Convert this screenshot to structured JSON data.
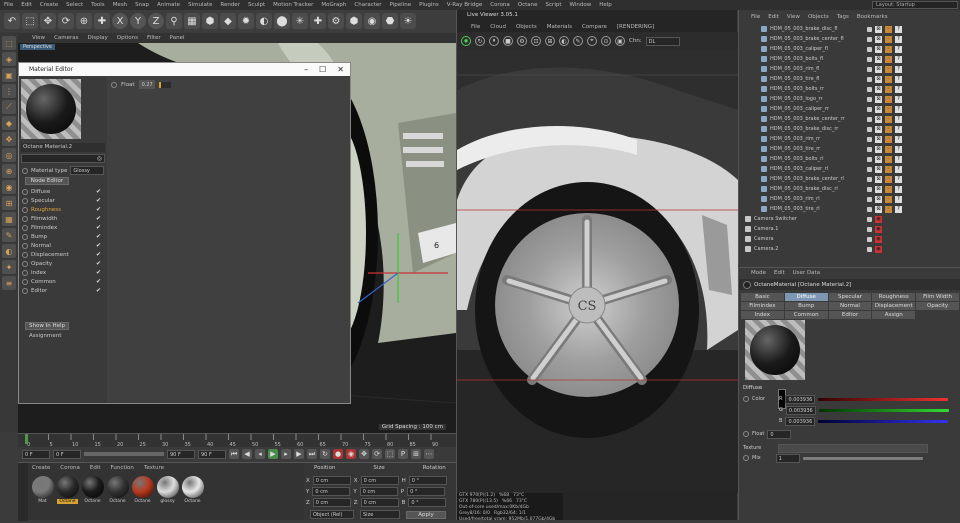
{
  "menubar": {
    "items": [
      "File",
      "Edit",
      "Create",
      "Select",
      "Tools",
      "Mesh",
      "Snap",
      "Animate",
      "Simulate",
      "Render",
      "Sculpt",
      "Motion Tracker",
      "MoGraph",
      "Character",
      "Pipeline",
      "Plugins",
      "V-Ray Bridge",
      "Corona",
      "Octane",
      "Script",
      "Window",
      "Help"
    ],
    "layout_label": "Layout:",
    "layout_value": "Startup"
  },
  "toolbar": {
    "undo": "↶",
    "icons": [
      "⬚",
      "✥",
      "⟳",
      "⊕",
      "✚",
      "X",
      "Y",
      "Z",
      "⚲",
      "▦",
      "⬢",
      "◆",
      "✹",
      "◐",
      "⬤",
      "✳",
      "✚",
      "⚙",
      "⬢",
      "◉",
      "⬣",
      "☀"
    ]
  },
  "viewport": {
    "menu": [
      "View",
      "Cameras",
      "Display",
      "Options",
      "Filter",
      "Panel"
    ],
    "perspective": "Perspective",
    "grid_spacing": "Grid Spacing : 100 cm",
    "badge_text": "6",
    "timeline_ticks": [
      "0",
      "5",
      "10",
      "15",
      "20",
      "25",
      "30",
      "35",
      "40",
      "45",
      "50",
      "55",
      "60",
      "65",
      "70",
      "75",
      "80",
      "85",
      "90"
    ],
    "frame_field": "0 F",
    "start_field": "0 F",
    "end_field": "90 F",
    "max_field": "90 F"
  },
  "material_editor": {
    "title": "Material Editor",
    "material_name": "Octane Material.2",
    "material_type_label": "Material type",
    "material_type_value": "Glossy",
    "node_editor": "Node Editor",
    "channels": [
      "Diffuse",
      "Specular",
      "Roughness",
      "Filmwidth",
      "Filmindex",
      "Bump",
      "Normal",
      "Displacement",
      "Opacity",
      "Index",
      "Common",
      "Editor"
    ],
    "active_channel": "Roughness",
    "show_in_help": "Show In Help",
    "assignment": "Assignment",
    "float_label": "Float",
    "float_value": "0.27"
  },
  "material_panel": {
    "menu": [
      "Create",
      "Corona",
      "Edit",
      "Function",
      "Texture"
    ],
    "balls": [
      {
        "label": "Mat",
        "color": "#7a7a7a"
      },
      {
        "label": "Octane",
        "color": "#2a2a2a"
      },
      {
        "label": "Octane",
        "color": "#1a1a1a"
      },
      {
        "label": "Octane",
        "color": "#333333"
      },
      {
        "label": "Octane",
        "color": "#b83a1e"
      },
      {
        "label": "glossy",
        "color": "#dddddd"
      },
      {
        "label": "Octane",
        "color": "#e8e8e8"
      }
    ],
    "selected_index": 1
  },
  "coordinates": {
    "headers": [
      "Position",
      "Size",
      "Rotation"
    ],
    "rows": [
      {
        "axis": "X",
        "pos": "0 cm",
        "size_axis": "X",
        "size": "0 cm",
        "rot_axis": "H",
        "rot": "0 °"
      },
      {
        "axis": "Y",
        "pos": "0 cm",
        "size_axis": "Y",
        "size": "0 cm",
        "rot_axis": "P",
        "rot": "0 °"
      },
      {
        "axis": "Z",
        "pos": "0 cm",
        "size_axis": "Z",
        "size": "0 cm",
        "rot_axis": "B",
        "rot": "0 °"
      }
    ],
    "mode_object": "Object (Rel)",
    "mode_size": "Size",
    "apply": "Apply"
  },
  "live_viewer": {
    "title": "Live Viewer 3.05.1",
    "menu": [
      "File",
      "Cloud",
      "Objects",
      "Materials",
      "Compare",
      "[RENDERING]"
    ],
    "channel_label": "Chn:",
    "channel_value": "DL",
    "stats": [
      {
        "a": "GTX 970(P)(1.2)",
        "b": "%68",
        "c": "73°C"
      },
      {
        "a": "GTX 780(P)(13.5)",
        "b": "%66",
        "c": "73°C"
      },
      {
        "a": "Out-of-core used/max:0Kb/4Gb",
        "b": "",
        "c": ""
      },
      {
        "a": "Grey8/16: 0/0",
        "b": "Rgb32/64: 1/1",
        "c": ""
      },
      {
        "a": "Used/free/total vram: 952Mb/1.077Gb/4Gb",
        "b": "",
        "c": ""
      }
    ],
    "wheel_logo": "CS"
  },
  "object_manager": {
    "menu": [
      "File",
      "Edit",
      "View",
      "Objects",
      "Tags",
      "Bookmarks"
    ],
    "objects": [
      "HDM_05_003_brake_disc_fl",
      "HDM_05_003_brake_center_fl",
      "HDM_05_003_caliper_fl",
      "HDM_05_003_bolts_fl",
      "HDM_05_003_rim_fl",
      "HDM_05_003_tire_fl",
      "HDM_05_003_bolts_rr",
      "HDM_05_003_logo_rr",
      "HDM_05_003_caliper_rr",
      "HDM_05_003_brake_center_rr",
      "HDM_05_003_brake_disc_rr",
      "HDM_05_003_rim_rr",
      "HDM_05_003_tire_rr",
      "HDM_05_003_bolts_rl",
      "HDM_05_003_caliper_rl",
      "HDM_05_003_brake_center_rl",
      "HDM_05_003_brake_disc_rl",
      "HDM_05_003_rim_rl",
      "HDM_05_003_tire_rl",
      "Camera Switcher",
      "Camera.1",
      "Camera",
      "Camera.2"
    ]
  },
  "attribute_manager": {
    "menu": [
      "Mode",
      "Edit",
      "User Data"
    ],
    "object_name": "OctaneMaterial [Octane Material.2]",
    "tabs": [
      "Basic",
      "Diffuse",
      "Specular",
      "Roughness",
      "Film Width",
      "Filmindex",
      "Bump",
      "Normal",
      "Displacement",
      "Opacity",
      "Index",
      "Common",
      "Editor",
      "Assign"
    ],
    "active_tab": "Diffuse",
    "section": "Diffuse",
    "color_label": "Color",
    "r_label": "R",
    "r_value": "0.003936",
    "g_label": "G",
    "g_value": "0.003936",
    "b_label": "B",
    "b_value": "0.003936",
    "float_label": "Float",
    "float_value": "0",
    "texture_label": "Texture",
    "mix_label": "Mix",
    "mix_value": "1"
  }
}
